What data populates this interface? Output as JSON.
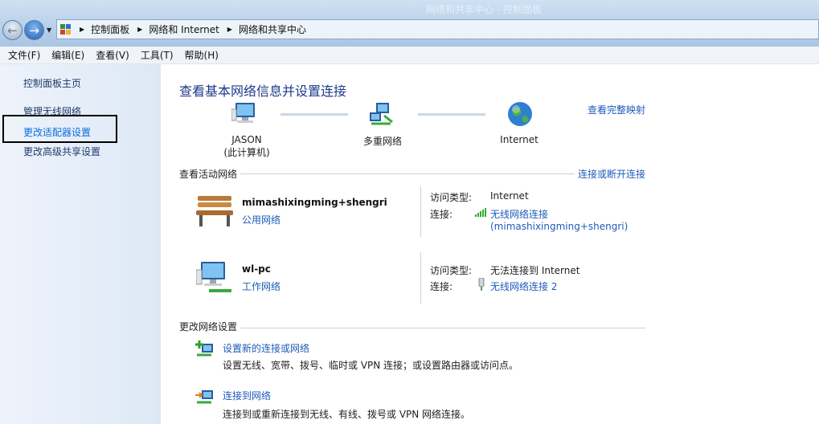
{
  "window": {
    "ghost_title": "网络和共享中心 - 控制面板",
    "breadcrumb": [
      "控制面板",
      "网络和 Internet",
      "网络和共享中心"
    ]
  },
  "menu": [
    "文件(F)",
    "编辑(E)",
    "查看(V)",
    "工具(T)",
    "帮助(H)"
  ],
  "sidebar": {
    "items": [
      {
        "label": "控制面板主页"
      },
      {
        "label": "管理无线网络"
      },
      {
        "label": "更改适配器设置"
      },
      {
        "label": "更改高级共享设置"
      }
    ]
  },
  "main": {
    "title": "查看基本网络信息并设置连接",
    "full_map_link": "查看完整映射",
    "nodes": {
      "computer_name": "JASON",
      "computer_sub": "(此计算机)",
      "multi": "多重网络",
      "internet": "Internet"
    },
    "active_section": {
      "label": "查看活动网络",
      "connect_link": "连接或断开连接"
    },
    "networks": [
      {
        "name": "mimashixingming+shengri",
        "type": "公用网络",
        "access_label": "访问类型:",
        "access_value": "Internet",
        "conn_label": "连接:",
        "conn_value": "无线网络连接",
        "conn_value2": "(mimashixingming+shengri)"
      },
      {
        "name": "wl-pc",
        "type": "工作网络",
        "access_label": "访问类型:",
        "access_value": "无法连接到 Internet",
        "conn_label": "连接:",
        "conn_value": "无线网络连接 2"
      }
    ],
    "change_section": {
      "label": "更改网络设置",
      "items": [
        {
          "title": "设置新的连接或网络",
          "desc": "设置无线、宽带、拨号、临时或 VPN 连接；或设置路由器或访问点。"
        },
        {
          "title": "连接到网络",
          "desc": "连接到或重新连接到无线、有线、拨号或 VPN 网络连接。"
        }
      ]
    }
  },
  "colors": {
    "title_blue": "#1e3a8a",
    "link_blue": "#1e5bb8",
    "sidebar_bg": "#e6eef8"
  }
}
